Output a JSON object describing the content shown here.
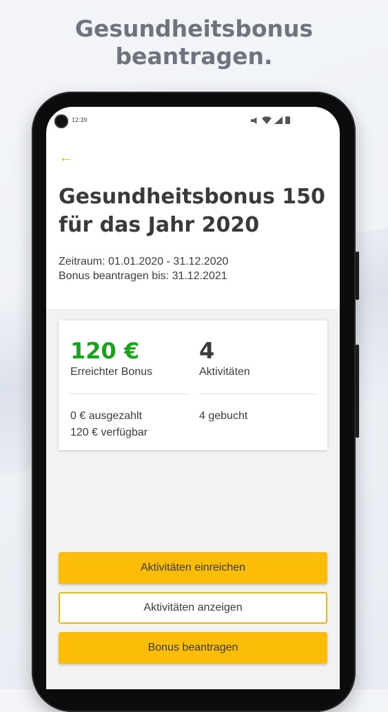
{
  "headline": {
    "line1": "Gesundheitsbonus",
    "line2": "beantragen."
  },
  "statusbar": {
    "time": "12:39",
    "icons": [
      "mute-icon",
      "wifi-icon",
      "signal-icon",
      "battery-icon"
    ]
  },
  "header": {
    "back_icon": "arrow-left-icon",
    "back_glyph": "←",
    "title": "Gesundheitsbonus 150 für das Jahr 2020"
  },
  "meta": {
    "period": "Zeitraum: 01.01.2020 - 31.12.2020",
    "deadline": "Bonus beantragen bis: 31.12.2021"
  },
  "summary": {
    "bonus": {
      "value": "120 €",
      "label": "Erreichter Bonus",
      "paid": "0 € ausgezahlt",
      "available": "120 € verfügbar"
    },
    "activities": {
      "value": "4",
      "label": "Aktivitäten",
      "booked": "4 gebucht"
    }
  },
  "actions": {
    "submit_label": "Aktivitäten einreichen",
    "show_label": "Aktivitäten anzeigen",
    "apply_label": "Bonus beantragen"
  },
  "colors": {
    "accent": "#fbbd07",
    "bonus_green": "#1aa31a",
    "text": "#3a3a3a"
  }
}
